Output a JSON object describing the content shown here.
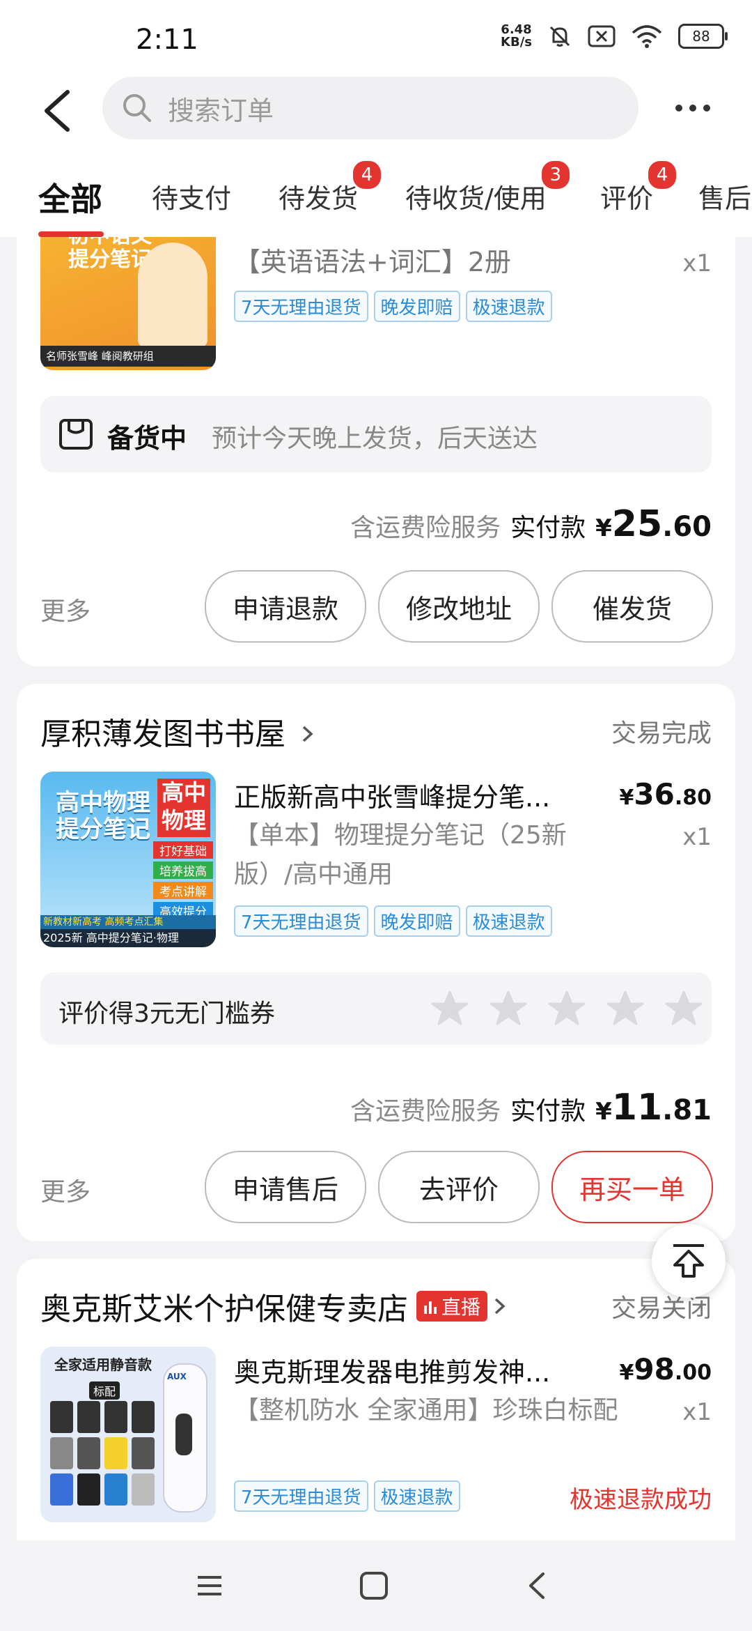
{
  "status_bar": {
    "time": "2:11",
    "net_speed_value": "6.48",
    "net_speed_unit": "KB/s",
    "battery": "88"
  },
  "header": {
    "search_placeholder": "搜索订单"
  },
  "tabs": [
    {
      "label": "全部",
      "badge": ""
    },
    {
      "label": "待支付",
      "badge": ""
    },
    {
      "label": "待发货",
      "badge": "4"
    },
    {
      "label": "待收货/使用",
      "badge": "3"
    },
    {
      "label": "评价",
      "badge": "4"
    },
    {
      "label": "售后",
      "badge": ""
    }
  ],
  "order1": {
    "thumb_text": "初中语文提分笔记",
    "thumb_caption": "名师张雪峰 峰阅教研组",
    "spec": "【英语语法+词汇】2册",
    "qty": "x1",
    "tags": [
      "7天无理由退货",
      "晚发即赔",
      "极速退款"
    ],
    "shipping_status": "备货中",
    "shipping_note": "预计今天晚上发货，后天送达",
    "insurance": "含运费险服务",
    "paid_label": "实付款",
    "paid_currency": "¥",
    "paid_int": "25",
    "paid_dec": ".60",
    "more": "更多",
    "buttons": [
      "申请退款",
      "修改地址",
      "催发货"
    ]
  },
  "order2": {
    "store": "厚积薄发图书书屋",
    "status": "交易完成",
    "thumb_title": "高中物理提分笔记",
    "thumb_side": "高中物理",
    "thumb_items": [
      "打好基础",
      "培养拔高",
      "考点讲解",
      "高效提分"
    ],
    "thumb_bottom1": "新教材新高考 高频考点汇集",
    "thumb_bottom2": "2025新 高中提分笔记·物理",
    "title": "正版新高中张雪峰提分笔...",
    "price_currency": "¥",
    "price_int": "36",
    "price_dec": ".80",
    "spec": "【单本】物理提分笔记（25新版）/高中通用",
    "qty": "x1",
    "tags": [
      "7天无理由退货",
      "晚发即赔",
      "极速退款"
    ],
    "review_prompt": "评价得3元无门槛券",
    "star_count": 5,
    "insurance": "含运费险服务",
    "paid_label": "实付款",
    "paid_currency": "¥",
    "paid_int": "11",
    "paid_dec": ".81",
    "more": "更多",
    "buttons": [
      "申请售后",
      "去评价",
      "再买一单"
    ]
  },
  "order3": {
    "store": "奥克斯艾米个护保健专卖店",
    "live_badge": "直播",
    "status": "交易关闭",
    "thumb_title": "全家适用静音款",
    "thumb_label": "标配",
    "thumb_brand": "AUX",
    "title": "奥克斯理发器电推剪发神...",
    "price_currency": "¥",
    "price_int": "98",
    "price_dec": ".00",
    "spec": "【整机防水 全家通用】珍珠白标配",
    "qty": "x1",
    "tags": [
      "7天无理由退货",
      "极速退款"
    ],
    "refund_status": "极速退款成功"
  },
  "colors": {
    "accent": "#e4342f",
    "tag_blue": "#2a8bd6",
    "bg": "#f3f3f5"
  }
}
